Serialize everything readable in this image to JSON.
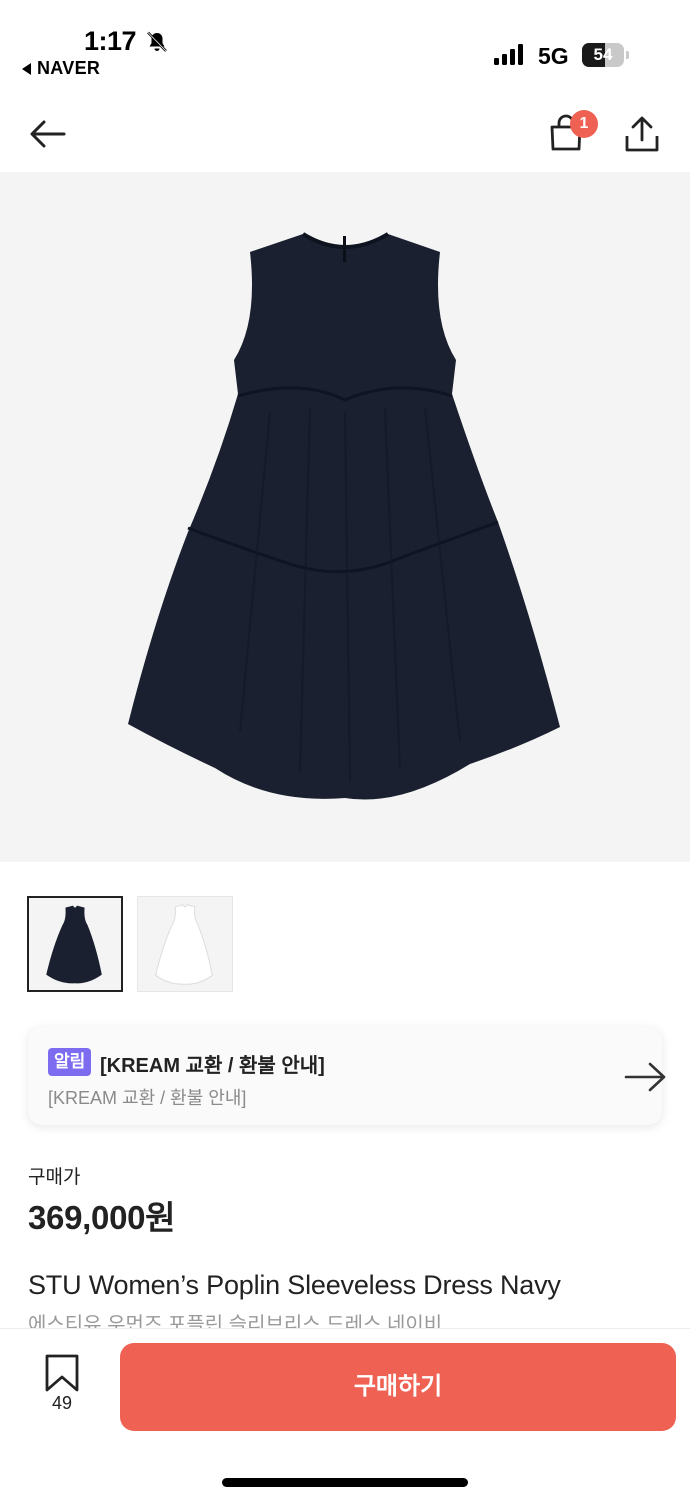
{
  "status_bar": {
    "time": "1:17",
    "back_app": "NAVER",
    "network": "5G",
    "battery": "54",
    "battery_level": 0.54
  },
  "nav": {
    "cart_count": "1"
  },
  "notice": {
    "badge": "알림",
    "title": "[KREAM 교환 / 환불 안내]",
    "subtitle": "[KREAM 교환 / 환불 안내]"
  },
  "price": {
    "label": "구매가",
    "value": "369,000원"
  },
  "product": {
    "name_en": "STU Women’s Poplin Sleeveless Dress Navy",
    "name_ko": "에스티유 우먼즈 포플린 슬리브리스 드레스 네이비",
    "colors": {
      "navy": "#1a2030",
      "white": "#ffffff"
    }
  },
  "bottom_bar": {
    "bookmark_count": "49",
    "buy_label": "구매하기"
  },
  "colors": {
    "accent": "#ef6253",
    "notice_badge": "#7d6cf0"
  }
}
